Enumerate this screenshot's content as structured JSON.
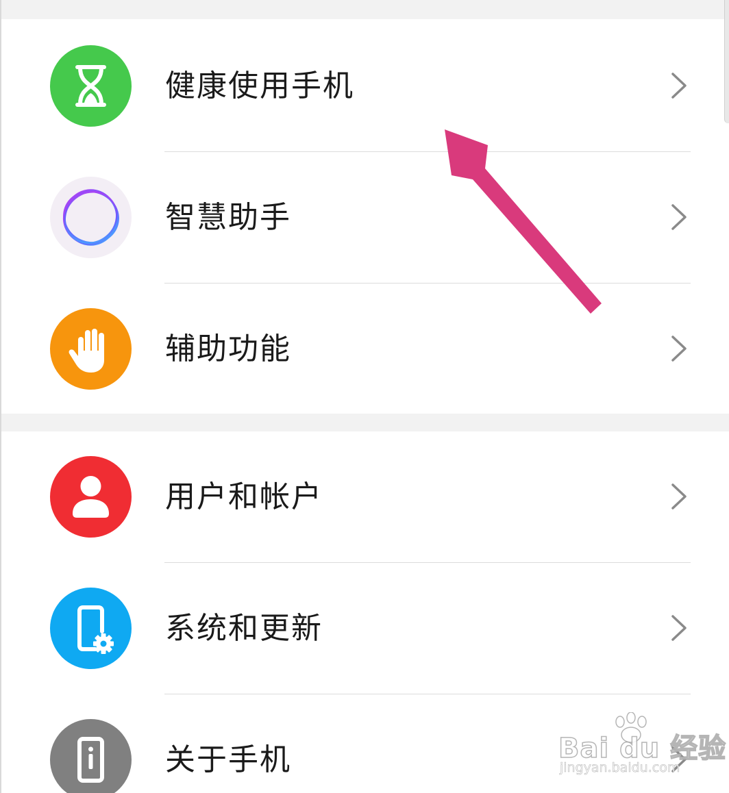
{
  "settings": {
    "group1": [
      {
        "id": "digital-balance",
        "label": "健康使用手机",
        "icon": "hourglass-icon",
        "color": "#45c94c"
      },
      {
        "id": "smart-assistant",
        "label": "智慧助手",
        "icon": "assistant-ring-icon",
        "color": "#f3eef5"
      },
      {
        "id": "accessibility",
        "label": "辅助功能",
        "icon": "hand-icon",
        "color": "#f7950d"
      }
    ],
    "group2": [
      {
        "id": "users-accounts",
        "label": "用户和帐户",
        "icon": "user-icon",
        "color": "#f02d33"
      },
      {
        "id": "system-update",
        "label": "系统和更新",
        "icon": "phone-gear-icon",
        "color": "#0fa9f2"
      },
      {
        "id": "about-phone",
        "label": "关于手机",
        "icon": "phone-info-icon",
        "color": "#808080"
      }
    ]
  },
  "annotation": {
    "arrow_color": "#d93a7c"
  },
  "watermark": {
    "brand": "Bai du 经验",
    "url": "jingyan.baidu.com"
  }
}
